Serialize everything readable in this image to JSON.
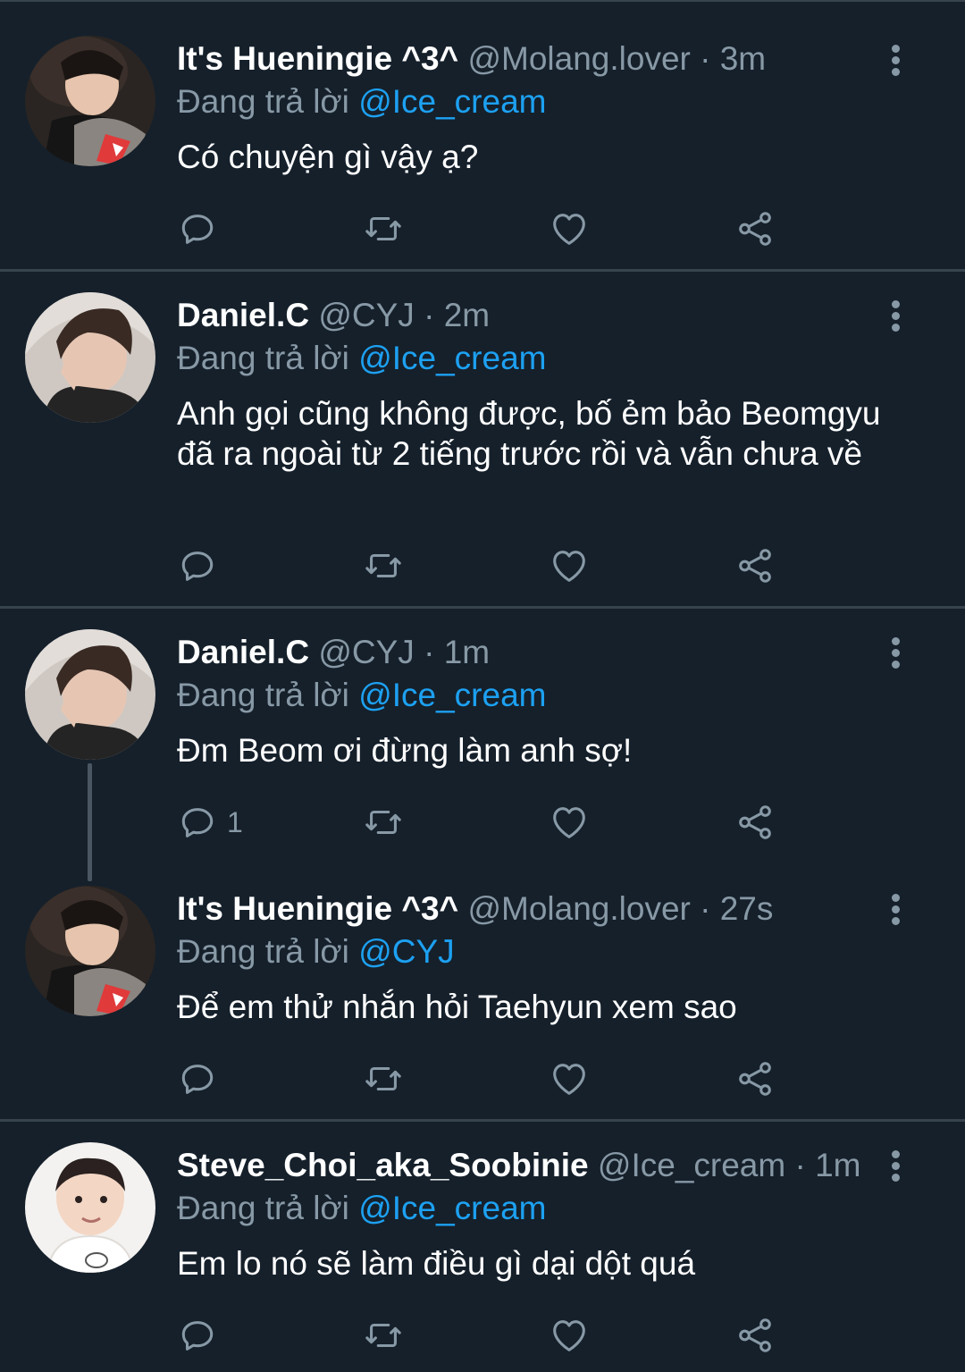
{
  "colors": {
    "background": "#15202b",
    "separator": "#38444d",
    "text": "#ffffff",
    "muted": "#8899a6",
    "accent": "#1da1f2"
  },
  "tweets": [
    {
      "name": "It's Hueningie ^3^",
      "handle": "@Molang.lover",
      "time": "3m",
      "reply_prefix": "Đang trả lời",
      "reply_to": "@Ice_cream",
      "text": "Có chuyện gì vậy ạ?",
      "reply_count": ""
    },
    {
      "name": "Daniel.C",
      "handle": "@CYJ",
      "time": "2m",
      "reply_prefix": "Đang trả lời",
      "reply_to": "@Ice_cream",
      "text": "Anh gọi cũng không được, bố ẻm bảo Beomgyu đã ra ngoài từ 2 tiếng trước rồi và vẫn chưa về",
      "reply_count": ""
    },
    {
      "name": "Daniel.C",
      "handle": "@CYJ",
      "time": "1m",
      "reply_prefix": "Đang trả lời",
      "reply_to": "@Ice_cream",
      "text": "Đm Beom ơi đừng làm anh sợ!",
      "reply_count": "1"
    },
    {
      "name": "It's Hueningie ^3^",
      "handle": "@Molang.lover",
      "time": "27s",
      "reply_prefix": "Đang trả lời",
      "reply_to": "@CYJ",
      "text": "Để em thử nhắn hỏi Taehyun xem sao",
      "reply_count": ""
    },
    {
      "name": "Steve_Choi_aka_Soobinie",
      "handle": "@Ice_cream",
      "time": "1m",
      "reply_prefix": "Đang trả lời",
      "reply_to": "@Ice_cream",
      "text": "Em lo nó sẽ làm điều gì dại dột quá",
      "reply_count": ""
    }
  ],
  "icons": {
    "reply": "reply-icon",
    "retweet": "retweet-icon",
    "like": "heart-icon",
    "share": "share-icon",
    "more": "more-vertical-icon"
  }
}
